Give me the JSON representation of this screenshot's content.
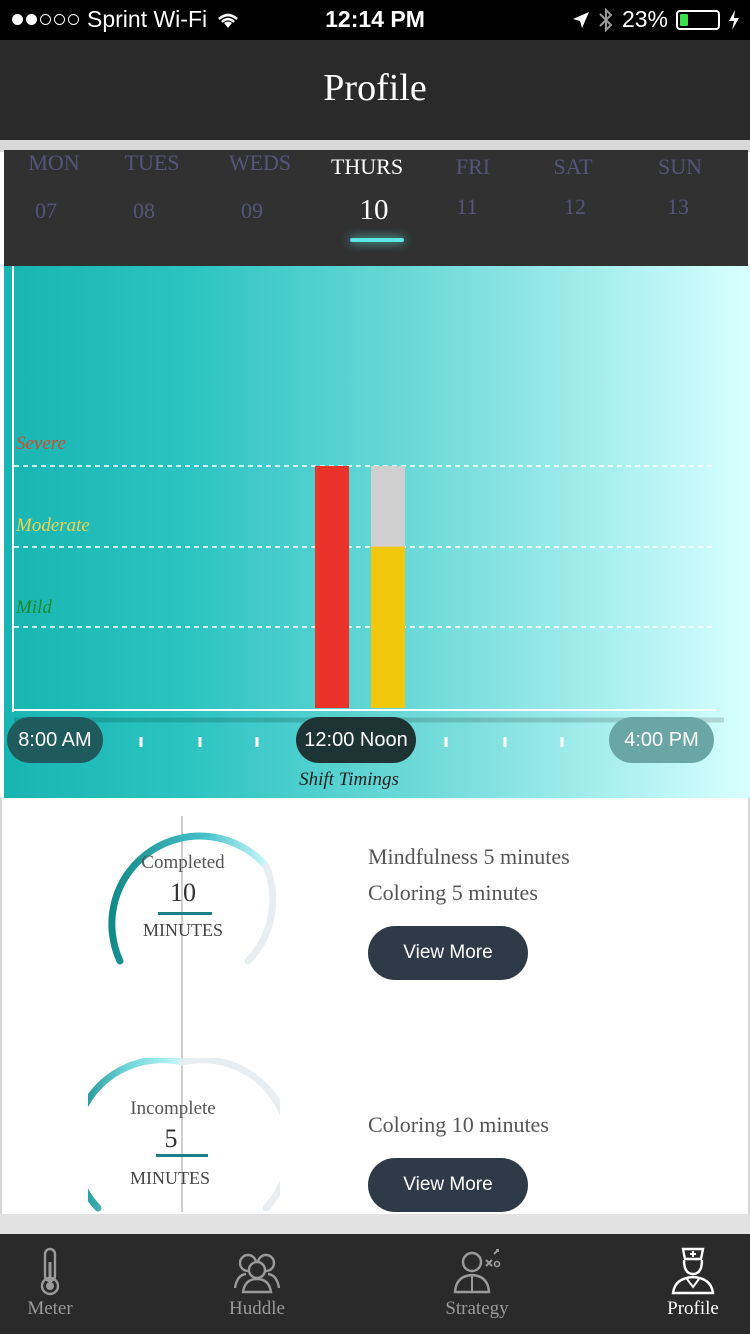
{
  "status_bar": {
    "carrier": "Sprint Wi-Fi",
    "time": "12:14 PM",
    "battery": "23%",
    "battery_level": 0.23,
    "signal_bars_filled": 2,
    "signal_bars_total": 5
  },
  "nav": {
    "title": "Profile"
  },
  "days": [
    {
      "name": "MON",
      "num": "07",
      "active": false
    },
    {
      "name": "TUES",
      "num": "08",
      "active": false
    },
    {
      "name": "WEDS",
      "num": "09",
      "active": false
    },
    {
      "name": "THURS",
      "num": "10",
      "active": true
    },
    {
      "name": "FRI",
      "num": "11",
      "active": false
    },
    {
      "name": "SAT",
      "num": "12",
      "active": false
    },
    {
      "name": "SUN",
      "num": "13",
      "active": false
    }
  ],
  "chart": {
    "levels": [
      "Severe",
      "Moderate",
      "Mild"
    ],
    "level_colors": {
      "Severe": "#d24a2a",
      "Moderate": "#f0d24a",
      "Mild": "#1b8a2e"
    },
    "time_labels": {
      "start": "8:00 AM",
      "mid": "12:00 Noon",
      "end": "4:00 PM"
    },
    "shift_label": "Shift Timings"
  },
  "chart_data": {
    "type": "bar",
    "categories": [
      "",
      ""
    ],
    "series": [
      {
        "values": [
          3,
          3
        ],
        "colors": [
          "#e8322a",
          "#cfcfcf"
        ]
      },
      {
        "values": [
          0,
          2
        ],
        "colors": [
          "#e8322a",
          "#f2c80f"
        ]
      }
    ],
    "ylim": [
      0,
      3
    ],
    "y_levels": [
      "Mild",
      "Moderate",
      "Severe"
    ],
    "xlabel": "Shift Timings",
    "x_ticks": [
      "8:00 AM",
      "12:00 Noon",
      "4:00 PM"
    ],
    "grid": true
  },
  "summary": {
    "completed": {
      "label": "Completed",
      "value": "10",
      "unit": "MINUTES",
      "activities": [
        "Mindfulness 5 minutes",
        "Coloring 5 minutes"
      ],
      "button": "View More"
    },
    "incomplete": {
      "label": "Incomplete",
      "value": "5",
      "unit": "MINUTES",
      "activities": [
        "Coloring 10 minutes"
      ],
      "button": "View More"
    }
  },
  "tabs": [
    {
      "label": "Meter",
      "icon": "thermometer-icon",
      "active": false
    },
    {
      "label": "Huddle",
      "icon": "group-icon",
      "active": false
    },
    {
      "label": "Strategy",
      "icon": "strategy-icon",
      "active": false
    },
    {
      "label": "Profile",
      "icon": "nurse-profile-icon",
      "active": true
    }
  ]
}
